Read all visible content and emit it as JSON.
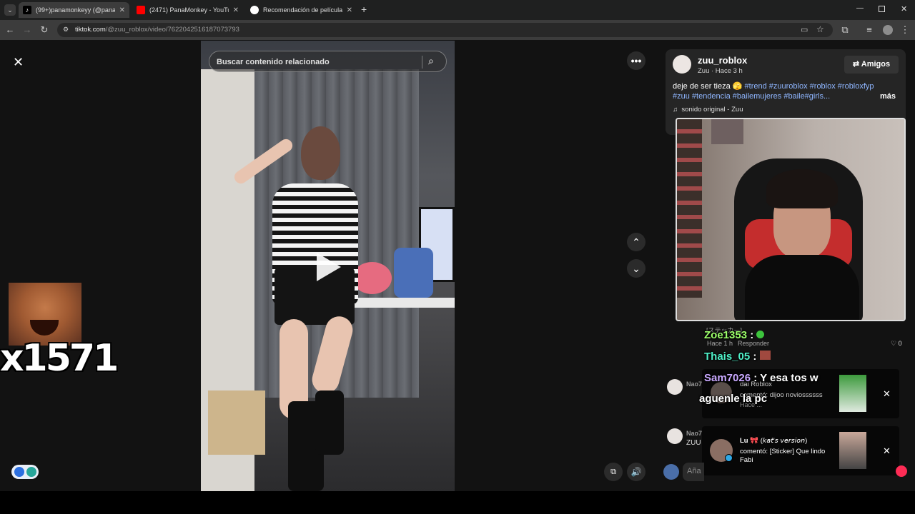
{
  "browser": {
    "tabs": [
      {
        "title": "(99+)panamonkeyy (@panamo",
        "active": true,
        "favicon": "tiktok-icon"
      },
      {
        "title": "(2471) PanaMonkey - YouTube",
        "active": false,
        "favicon": "youtube-icon"
      },
      {
        "title": "Recomendación de película",
        "active": false,
        "favicon": "chatgpt-icon"
      }
    ],
    "url_domain": "tiktok.com",
    "url_path": "/@zuu_roblox/video/7622042516187073793"
  },
  "search": {
    "placeholder": "Buscar contenido relacionado"
  },
  "post": {
    "username": "zuu_roblox",
    "meta": "Zuu · Hace 3 h",
    "friends_button": "Amigos",
    "caption_text": "deje de ser tieza 🫣",
    "hashtags_line1": "#trend #zuuroblox #roblox #robloxfyp",
    "hashtags_line2": "#zuu #tendencia #bailemujeres #baile#girls...",
    "more_label": "más",
    "sound": "sonido original - Zuu"
  },
  "overlay_left": {
    "counter": "x1571"
  },
  "chat": {
    "line1_user": "Zoe1353",
    "line2_user": "Thais_05",
    "line3_user": "Sam7026",
    "line3_text": "Y esa tos w",
    "line3_text2": "aguenle la pc",
    "bg_sticker": "[ステッカー]",
    "bg_time": "Hace 1 h",
    "bg_reply": "Responder",
    "bg_likes": "0",
    "bg_user2": "Nao7",
    "bg_user3": "Nao7",
    "bg_zuu": "ZUU"
  },
  "notifications": [
    {
      "name": "dai Roblox",
      "text": "comentó: dijoo noviossssss",
      "extra": "Hace ..."
    },
    {
      "name": "Lu",
      "name_suffix": "(𝘬𝘢𝘵'𝘴 𝘷𝘦𝘳𝘴𝘪𝘰𝘯)",
      "text": "comentó: [Sticker] Que lindo Fabi"
    }
  ],
  "comment_input": {
    "placeholder": "Aña"
  },
  "colors": {
    "accent": "#fe2c55",
    "hashtag": "#8fb6ff",
    "zoe": "#9cff6a",
    "thais": "#4ff0c8",
    "sam": "#c9a9ff"
  }
}
